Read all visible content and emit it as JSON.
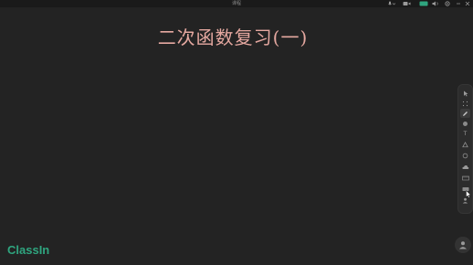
{
  "window": {
    "title": "课程"
  },
  "board": {
    "title": "二次函数复习(一)",
    "title_color": "#e5a8a0",
    "background": "#232323"
  },
  "toolbar": {
    "tools": [
      {
        "name": "select",
        "icon": "arrow-pointer-icon"
      },
      {
        "name": "drag",
        "icon": "dots-grid-icon"
      },
      {
        "name": "pen",
        "icon": "pen-icon",
        "active": true
      },
      {
        "name": "highlighter",
        "icon": "circle-marker-icon"
      },
      {
        "name": "text",
        "icon": "text-icon",
        "glyph": "T"
      },
      {
        "name": "shape",
        "icon": "shape-icon"
      },
      {
        "name": "eraser",
        "icon": "eraser-icon"
      },
      {
        "name": "cloud",
        "icon": "cloud-icon"
      },
      {
        "name": "ruler",
        "icon": "ruler-icon"
      },
      {
        "name": "more",
        "icon": "more-icon"
      },
      {
        "name": "user",
        "icon": "user-icon"
      }
    ]
  },
  "top_controls": {
    "mic_icon": "microphone-icon",
    "camera_icon": "camera-icon",
    "screen_icon": "screen-share-icon",
    "accent": "#2fa57f"
  },
  "logo": {
    "text": "ClassIn",
    "color": "#2fa57f"
  }
}
